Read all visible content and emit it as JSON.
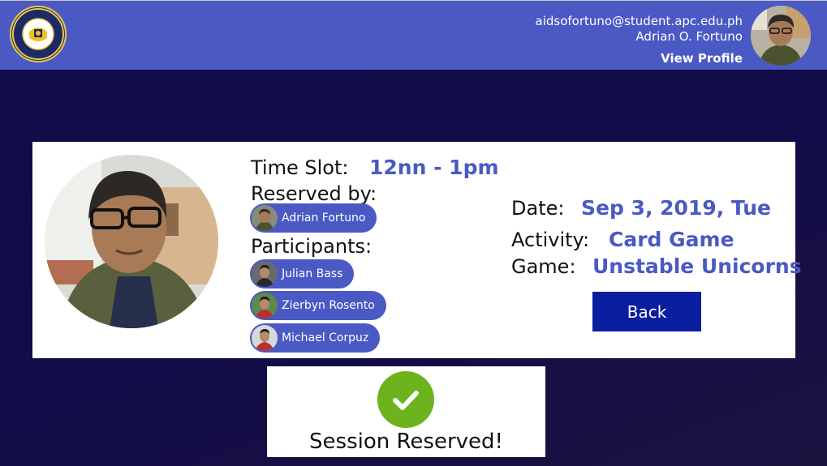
{
  "header": {
    "logo_text": "ASIA PACIFIC COLLEGE",
    "logo_year": "1991",
    "user_email": "aidsofortuno@student.apc.edu.ph",
    "user_name": "Adrian O. Fortuno",
    "view_profile_label": "View Profile"
  },
  "reservation": {
    "time_slot_label": "Time Slot:",
    "time_slot_value": "12nn - 1pm",
    "reserved_by_label": "Reserved by:",
    "reserved_by": "Adrian Fortuno",
    "participants_label": "Participants:",
    "participants": [
      "Julian Bass",
      "Zierbyn Rosento",
      "Michael Corpuz"
    ],
    "date_label": "Date:",
    "date_value": "Sep 3, 2019, Tue",
    "activity_label": "Activity:",
    "activity_value": "Card Game",
    "game_label": "Game:",
    "game_value": "Unstable Unicorns",
    "back_label": "Back"
  },
  "confirmation": {
    "message": "Session Reserved!"
  },
  "colors": {
    "header_bg": "#4a59c4",
    "page_bg": "#110c4a",
    "accent_text": "#4a59c4",
    "button_bg": "#0a1ea0",
    "check_green": "#6db31e"
  },
  "icons": {
    "logo": "college-seal-icon",
    "confirm": "checkmark-icon"
  }
}
